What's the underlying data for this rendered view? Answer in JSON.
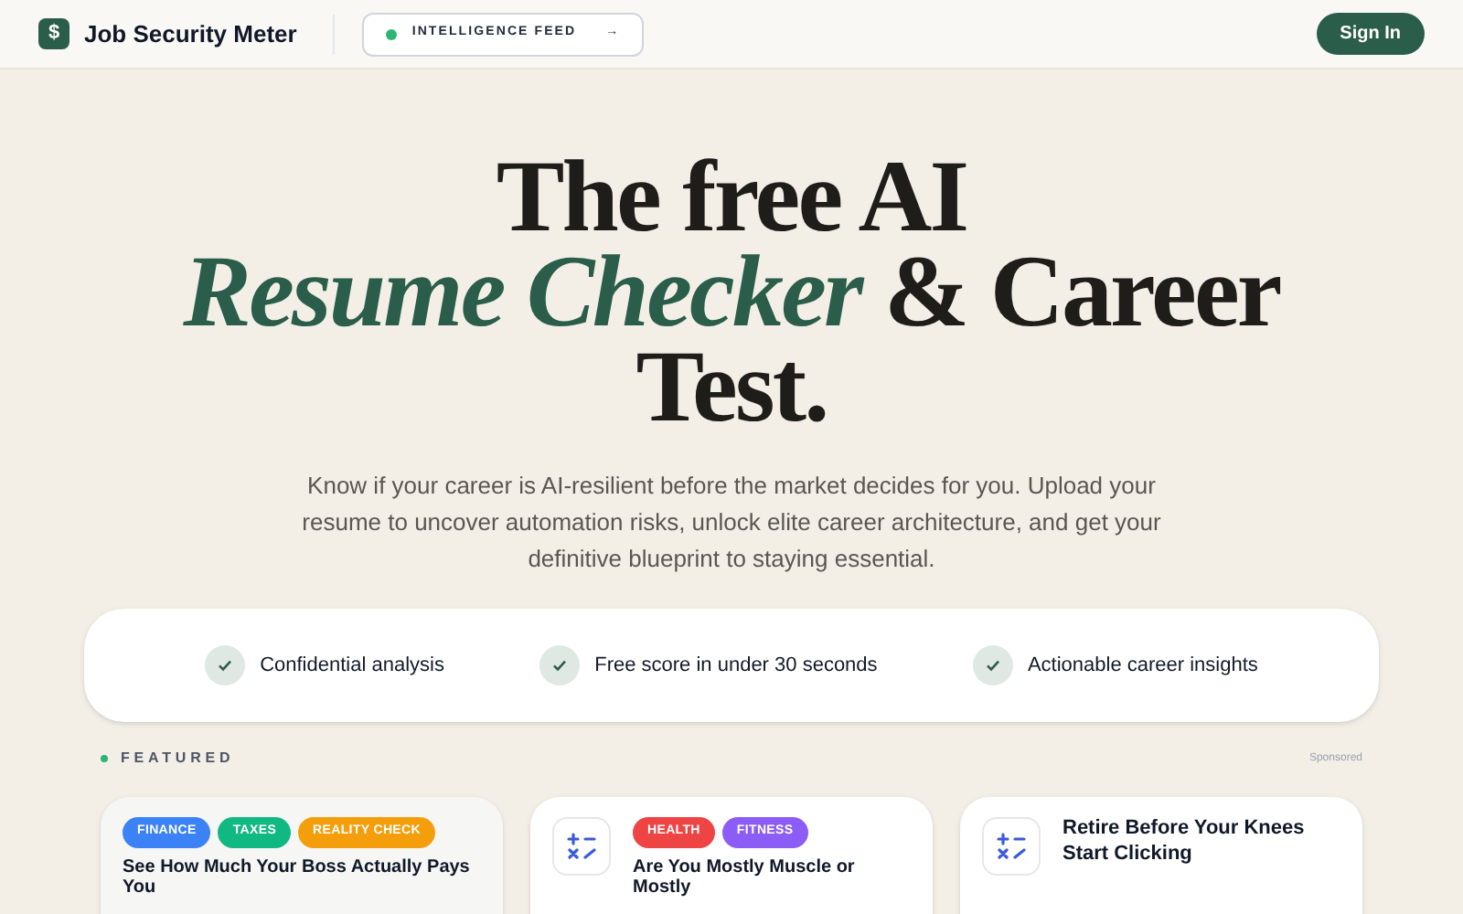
{
  "header": {
    "logo_glyph": "$",
    "brand": "Job Security Meter",
    "feed_link": "INTELLIGENCE FEED",
    "feed_arrow": "→",
    "sign_in": "Sign In"
  },
  "hero": {
    "title_line_1": "The free AI",
    "title_accent": "Resume Checker",
    "title_rest": " & Career",
    "title_line_3": "Test.",
    "subtitle": "Know if your career is AI-resilient before the market decides for you. Upload your resume to uncover automation risks, unlock elite career architecture, and get your definitive blueprint to staying essential."
  },
  "features": [
    {
      "label": "Confidential analysis"
    },
    {
      "label": "Free score in under 30 seconds"
    },
    {
      "label": "Actionable career insights"
    }
  ],
  "featured": {
    "heading": "FEATURED",
    "sponsored": "Sponsored",
    "cards": [
      {
        "kind": "tags",
        "tags": [
          {
            "label": "FINANCE",
            "color": "#3b82f6"
          },
          {
            "label": "TAXES",
            "color": "#10b981"
          },
          {
            "label": "REALITY CHECK",
            "color": "#f59e0b"
          }
        ],
        "title": "See How Much Your Boss Actually Pays You"
      },
      {
        "kind": "icon-tags",
        "tags": [
          {
            "label": "HEALTH",
            "color": "#ef4444"
          },
          {
            "label": "FITNESS",
            "color": "#8b5cf6"
          }
        ],
        "title": "Are You Mostly Muscle or Mostly"
      },
      {
        "kind": "icon-title",
        "title": "Retire Before Your Knees Start Clicking"
      }
    ]
  }
}
